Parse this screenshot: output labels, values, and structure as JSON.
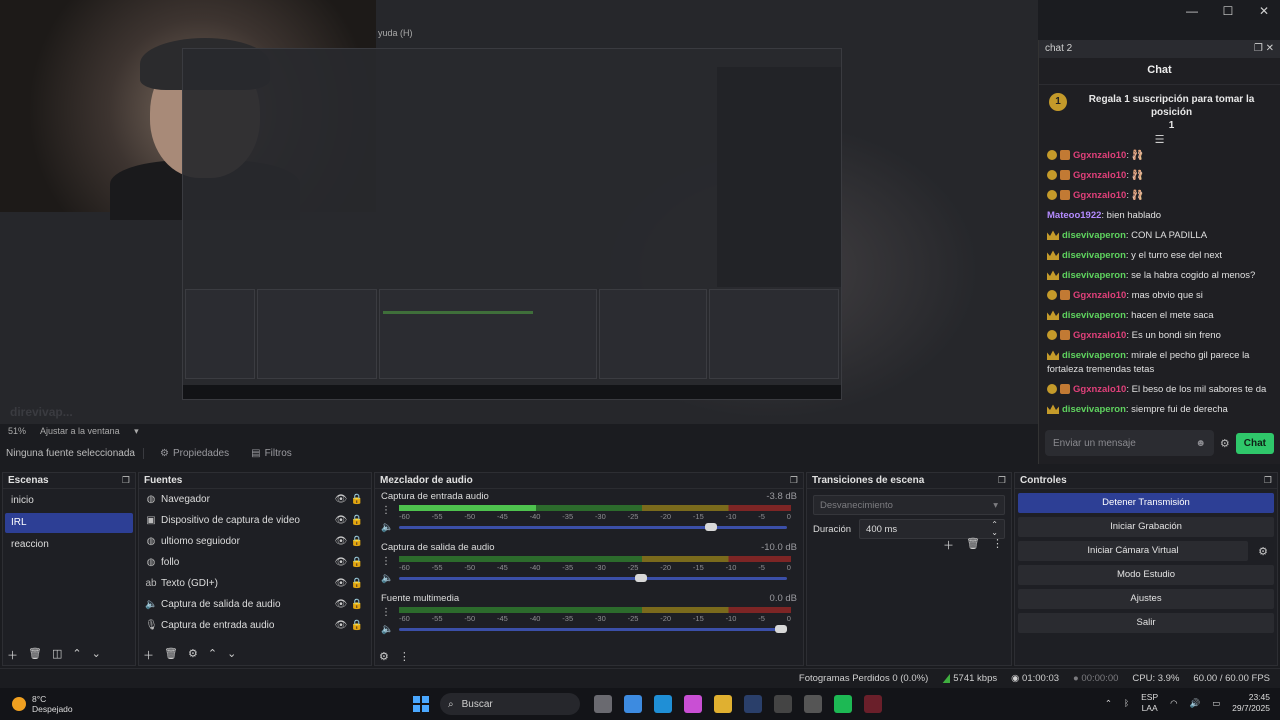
{
  "window": {
    "menu_hint": "yuda (H)",
    "controls": [
      "—",
      "☐",
      "✕"
    ]
  },
  "preview": {
    "blur_text": "direvivap..."
  },
  "zoom": {
    "percent": "51%",
    "fit_label": "Ajustar a la ventana"
  },
  "chat": {
    "dock_title": "chat 2",
    "header": "Chat",
    "pinned_text": "Regala 1 suscripción para tomar la posición",
    "pinned_num": "1",
    "messages": [
      {
        "badge": "gift",
        "user": "Ggxnzalo10",
        "color": "#e0407a",
        "text": " 🩰",
        "emote": true
      },
      {
        "badge": "gift",
        "user": "Ggxnzalo10",
        "color": "#e0407a",
        "text": " 🩰",
        "emote": true
      },
      {
        "badge": "gift",
        "user": "Ggxnzalo10",
        "color": "#e0407a",
        "text": " 🩰",
        "emote": true
      },
      {
        "badge": "none",
        "user": "Mateoo1922",
        "color": "#b48bff",
        "text": " bien hablado"
      },
      {
        "badge": "crown",
        "user": "disevivaperon",
        "color": "#5fd35f",
        "text": " CON LA PADILLA"
      },
      {
        "badge": "crown",
        "user": "disevivaperon",
        "color": "#5fd35f",
        "text": " y el turro ese del next"
      },
      {
        "badge": "crown",
        "user": "disevivaperon",
        "color": "#5fd35f",
        "text": " se la habra cogido al menos?"
      },
      {
        "badge": "gift",
        "user": "Ggxnzalo10",
        "color": "#e0407a",
        "text": " mas obvio que si"
      },
      {
        "badge": "crown",
        "user": "disevivaperon",
        "color": "#5fd35f",
        "text": " hacen el mete saca"
      },
      {
        "badge": "gift",
        "user": "Ggxnzalo10",
        "color": "#e0407a",
        "text": " Es un bondi sin freno"
      },
      {
        "badge": "crown",
        "user": "disevivaperon",
        "color": "#5fd35f",
        "text": " mirale el pecho gil parece la fortaleza tremendas tetas"
      },
      {
        "badge": "gift",
        "user": "Ggxnzalo10",
        "color": "#e0407a",
        "text": " El beso de los mil sabores te da"
      },
      {
        "badge": "crown",
        "user": "disevivaperon",
        "color": "#5fd35f",
        "text": " siempre fui de derecha"
      }
    ],
    "input_placeholder": "Enviar un mensaje",
    "send_label": "Chat"
  },
  "source_toolbar": {
    "no_source": "Ninguna fuente seleccionada",
    "properties": "Propiedades",
    "filters": "Filtros"
  },
  "scenes": {
    "title": "Escenas",
    "items": [
      "inicio",
      "IRL",
      "reaccion"
    ],
    "active_index": 1
  },
  "sources": {
    "title": "Fuentes",
    "items": [
      {
        "icon": "globe-icon",
        "glyph": "◍",
        "label": "Navegador"
      },
      {
        "icon": "camera-icon",
        "glyph": "▣",
        "label": "Dispositivo de captura de video"
      },
      {
        "icon": "globe-icon",
        "glyph": "◍",
        "label": "ultiomo seguiodor"
      },
      {
        "icon": "globe-icon",
        "glyph": "◍",
        "label": "follo"
      },
      {
        "icon": "text-icon",
        "glyph": "ab",
        "label": "Texto (GDI+)"
      },
      {
        "icon": "speaker-icon",
        "glyph": "🔈",
        "label": "Captura de salida de audio"
      },
      {
        "icon": "mic-icon",
        "glyph": "🎙",
        "label": "Captura de entrada audio"
      }
    ]
  },
  "mixer": {
    "title": "Mezclador de audio",
    "ticks": [
      "-60",
      "-55",
      "-50",
      "-45",
      "-40",
      "-35",
      "-30",
      "-25",
      "-20",
      "-15",
      "-10",
      "-5",
      "0"
    ],
    "channels": [
      {
        "name": "Captura de entrada audio",
        "db": "-3.8 dB",
        "level": 0.35,
        "fader": 0.82
      },
      {
        "name": "Captura de salida de audio",
        "db": "-10.0 dB",
        "level": 0.0,
        "fader": 0.64
      },
      {
        "name": "Fuente multimedia",
        "db": "0.0 dB",
        "level": 0.0,
        "fader": 1.0
      }
    ]
  },
  "transitions": {
    "title": "Transiciones de escena",
    "selected": "Desvanecimiento",
    "duration_label": "Duración",
    "duration_value": "400 ms"
  },
  "controls": {
    "title": "Controles",
    "stop_stream": "Detener Transmisión",
    "start_record": "Iniciar Grabación",
    "virtual_cam": "Iniciar Cámara Virtual",
    "studio_mode": "Modo Estudio",
    "settings": "Ajustes",
    "exit": "Salir"
  },
  "status": {
    "dropped": "Fotogramas Perdidos 0 (0.0%)",
    "bitrate": "5741 kbps",
    "stream_time": "01:00:03",
    "record_time": "00:00:00",
    "cpu": "CPU: 3.9%",
    "fps": "60.00 / 60.00 FPS"
  },
  "taskbar": {
    "temp": "8°C",
    "weather": "Despejado",
    "search": "Buscar",
    "lang1": "ESP",
    "lang2": "LAA",
    "time": "23:45",
    "date": "29/7/2025"
  }
}
